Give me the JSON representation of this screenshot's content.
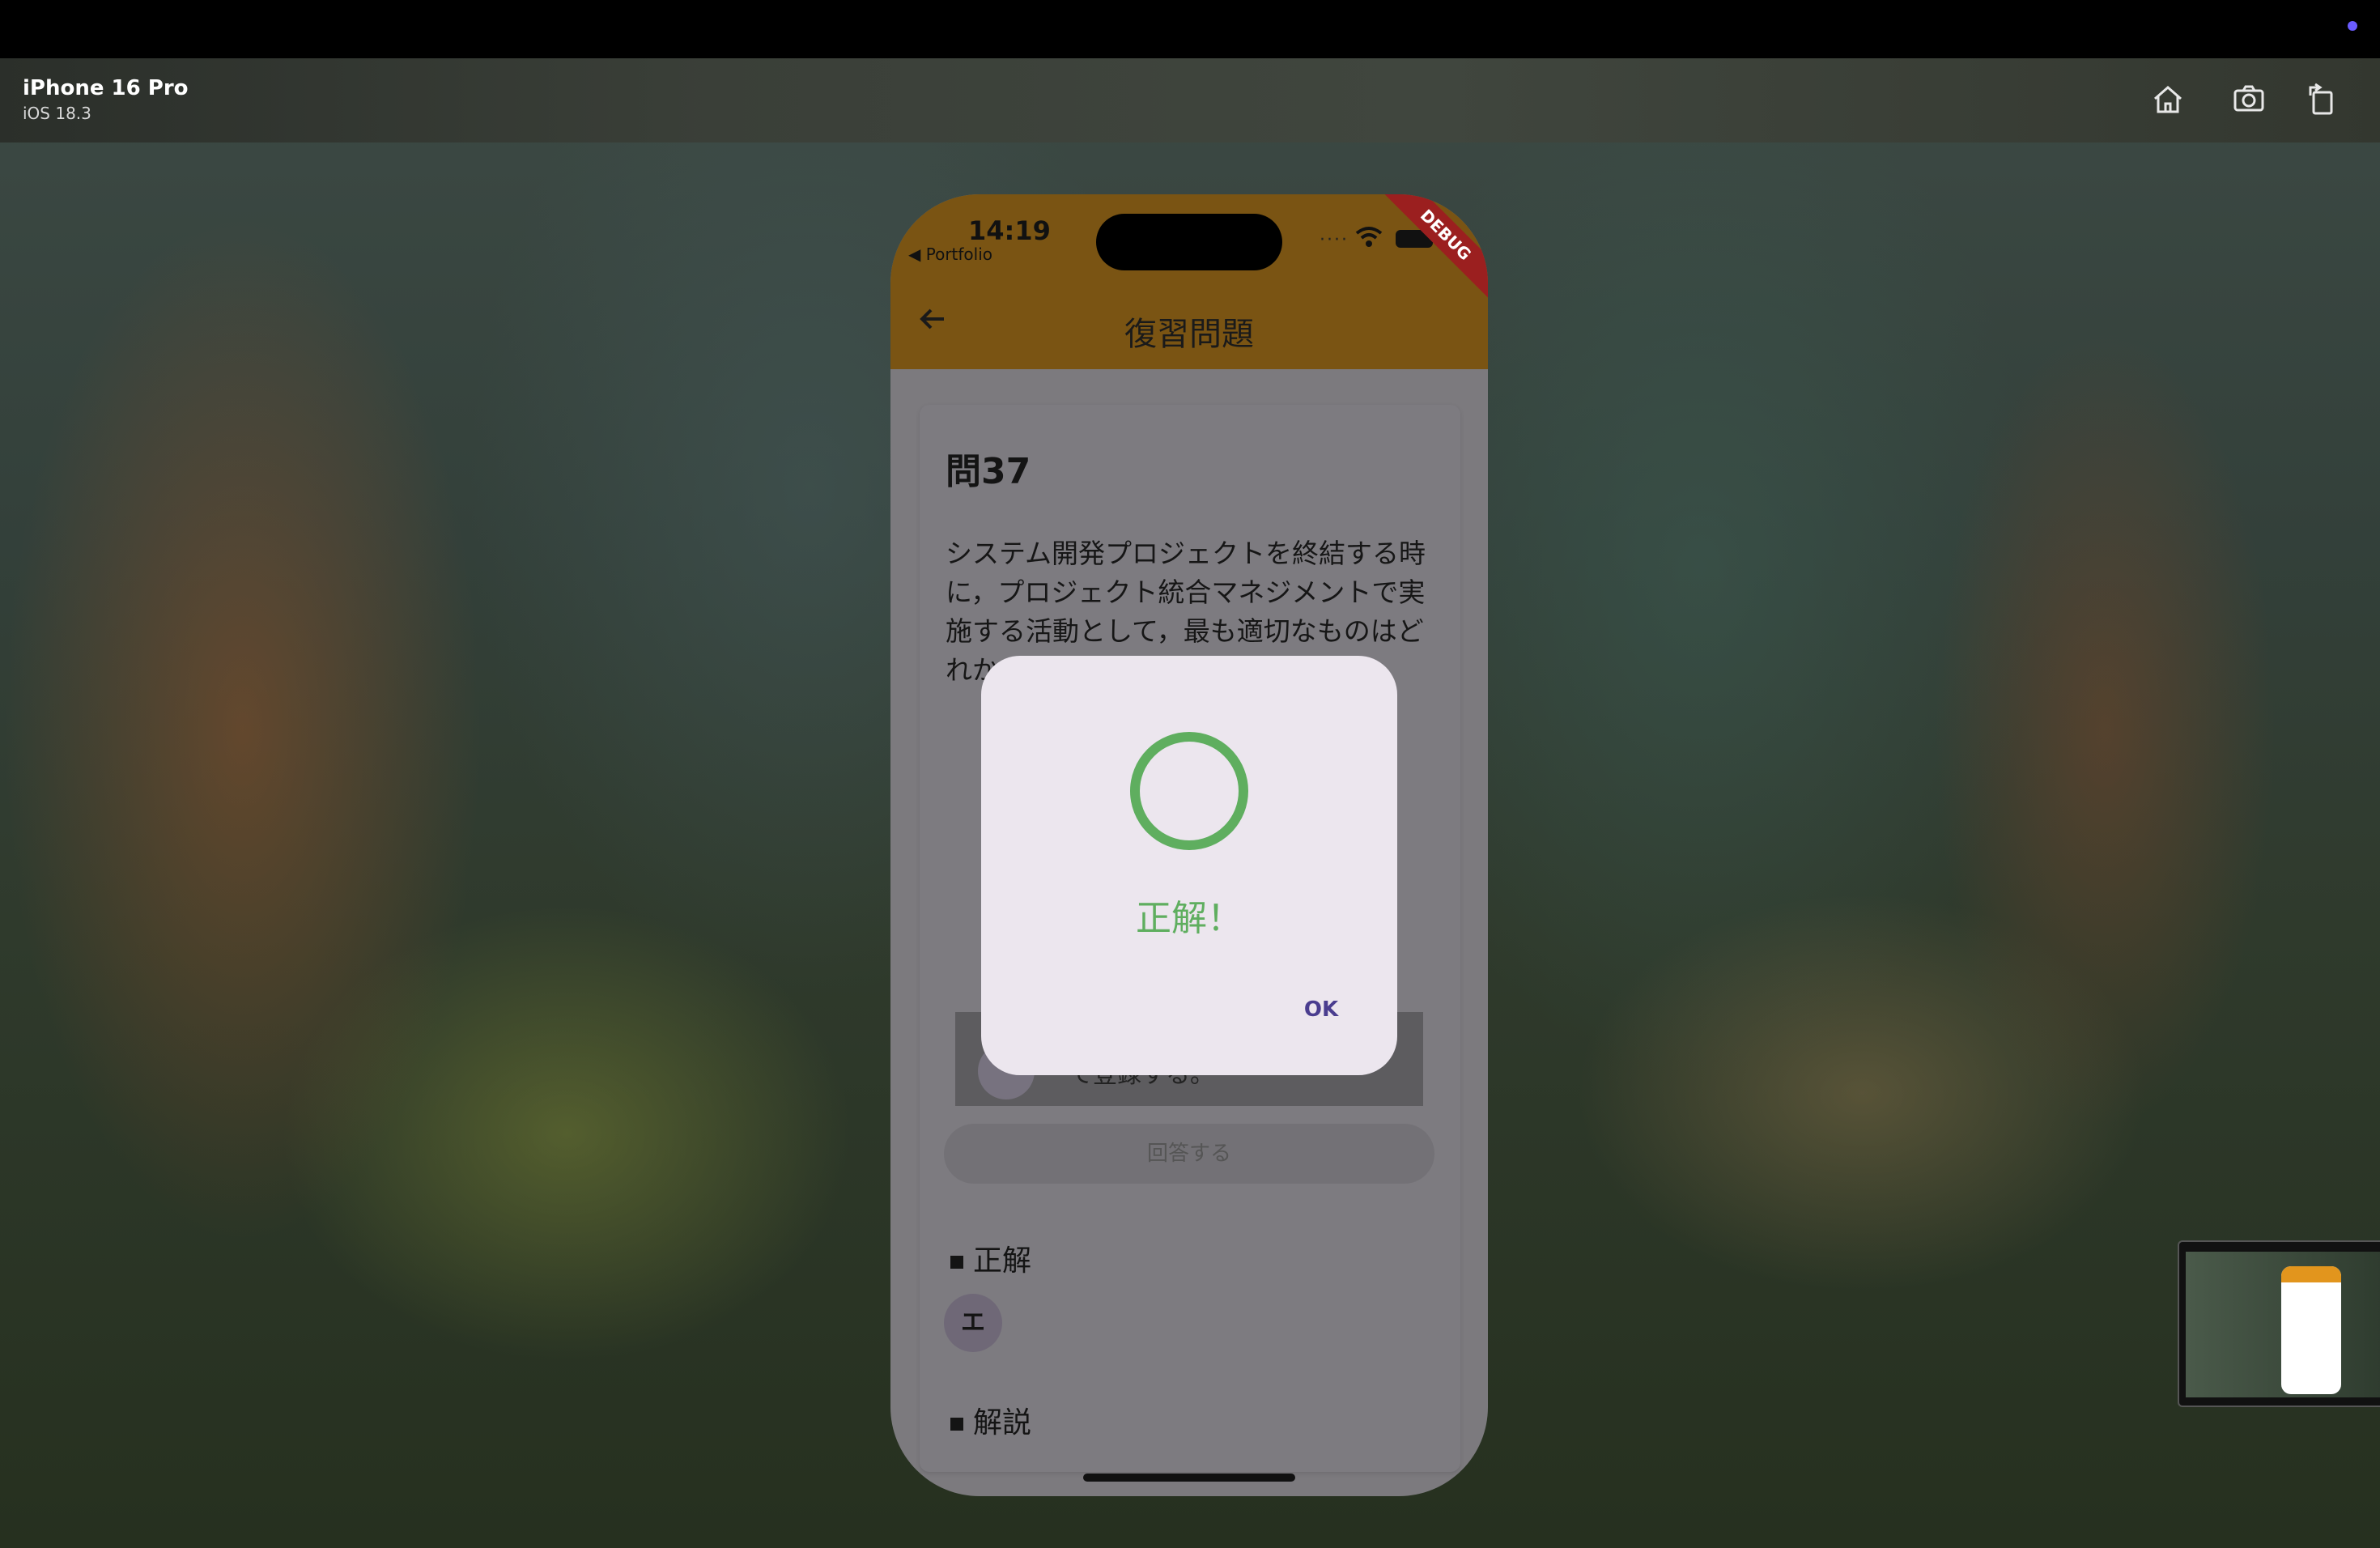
{
  "simulator": {
    "device_name": "iPhone 16 Pro",
    "os_version": "iOS 18.3",
    "toolbar_icons": [
      "home-icon",
      "screenshot-icon",
      "rotate-icon"
    ]
  },
  "status_bar": {
    "time": "14:19",
    "back_app": "◀ Portfolio",
    "debug_label": "DEBUG"
  },
  "app_bar": {
    "title": "復習問題"
  },
  "question": {
    "number": "問37",
    "text": "システム開発プロジェクトを終結する時に，プロジェクト統合マネジメントで実施する活動として，最も適切なものはどれか",
    "partial_choice_text": "て登録する。",
    "answer_button": "回答する"
  },
  "sections": {
    "correct_heading": "正解",
    "correct_value": "エ",
    "explanation_heading": "解説"
  },
  "dialog": {
    "message": "正解！",
    "ok_label": "OK"
  },
  "colors": {
    "app_bar": "#E2951D",
    "correct_green": "#5FAE5F",
    "dialog_button": "#4A3D8F",
    "debug_banner": "#B22222"
  }
}
